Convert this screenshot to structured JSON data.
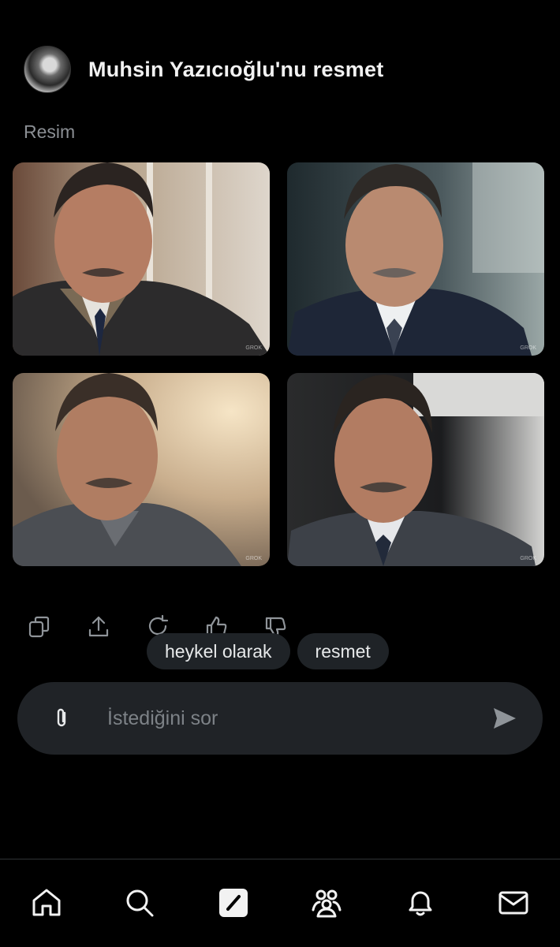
{
  "header": {
    "title": "Muhsin Yazıcıoğlu'nu resmet",
    "avatar_icon": "avatar-photo"
  },
  "section": {
    "label": "Resim"
  },
  "images": [
    {
      "icon": "portrait-image",
      "watermark": "GROK"
    },
    {
      "icon": "portrait-image",
      "watermark": "GROK"
    },
    {
      "icon": "portrait-image",
      "watermark": "GROK"
    },
    {
      "icon": "portrait-image",
      "watermark": "GROK"
    }
  ],
  "actions": [
    "copy-icon",
    "share-icon",
    "regenerate-icon",
    "thumbs-up-icon",
    "thumbs-down-icon"
  ],
  "suggestions": [
    "heykel olarak",
    "resmet"
  ],
  "composer": {
    "placeholder": "İstediğini sor",
    "attach_icon": "paperclip-icon",
    "send_icon": "send-icon"
  },
  "bottom_nav": [
    "home-icon",
    "search-icon",
    "grok-icon",
    "communities-icon",
    "notifications-icon",
    "messages-icon"
  ],
  "colors": {
    "background": "#000000",
    "surface": "#202327",
    "chip": "#1f2327",
    "muted": "#8b8f94"
  }
}
